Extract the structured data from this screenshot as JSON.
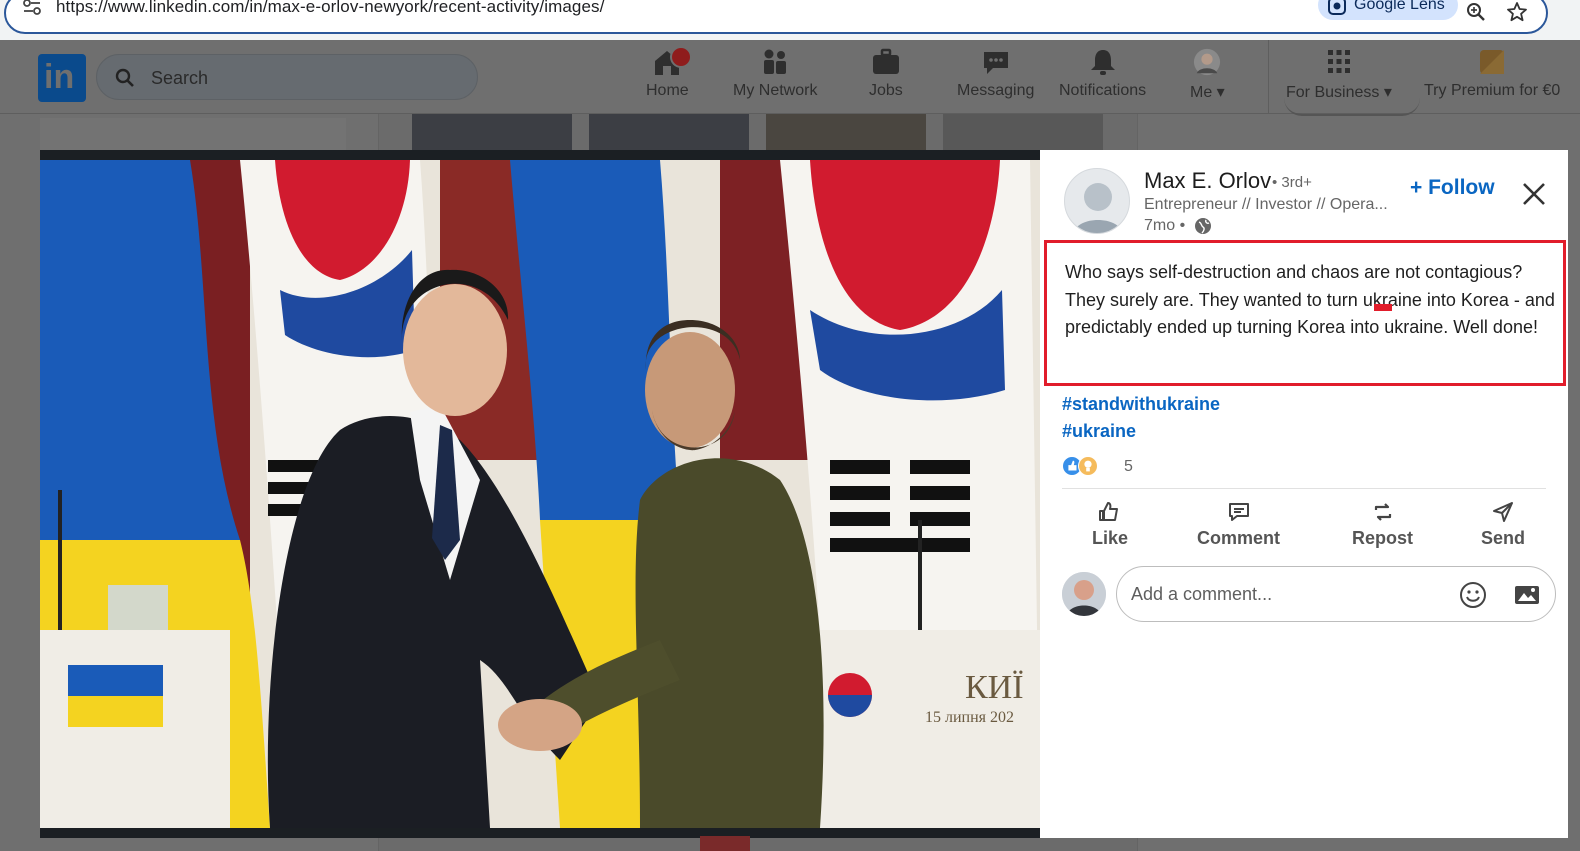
{
  "browser": {
    "url": "https://www.linkedin.com/in/max-e-orlov-newyork/recent-activity/images/",
    "lens_label": "Google Lens"
  },
  "header": {
    "logo_text": "in",
    "search_placeholder": "Search",
    "nav": [
      {
        "label": "Home",
        "icon": "home-icon",
        "badge": true
      },
      {
        "label": "My Network",
        "icon": "network-icon"
      },
      {
        "label": "Jobs",
        "icon": "briefcase-icon"
      },
      {
        "label": "Messaging",
        "icon": "message-icon"
      },
      {
        "label": "Notifications",
        "icon": "bell-icon"
      },
      {
        "label": "Me",
        "icon": "avatar-icon",
        "dropdown": true
      },
      {
        "label": "For Business",
        "icon": "grid-icon",
        "dropdown": true
      },
      {
        "label": "Try Premium for €0",
        "icon": "premium-icon"
      }
    ]
  },
  "post": {
    "author": "Max E. Orlov",
    "degree": "• 3rd+",
    "headline": "Entrepreneur // Investor // Opera...",
    "time": "7mo •",
    "follow_label": "+ Follow",
    "text": "Who says self-destruction and chaos are not contagious? They surely are. They wanted to turn ukraine into Korea - and predictably ended up turning Korea into ukraine. Well done!",
    "hashtags": [
      "#standwithukraine",
      "#ukraine"
    ],
    "reaction_count": "5",
    "actions": [
      {
        "label": "Like",
        "icon": "like-icon"
      },
      {
        "label": "Comment",
        "icon": "comment-icon"
      },
      {
        "label": "Repost",
        "icon": "repost-icon"
      },
      {
        "label": "Send",
        "icon": "send-icon"
      }
    ],
    "comment_placeholder": "Add a comment..."
  },
  "photo": {
    "podium_sign": "КИЇ",
    "podium_date": "15 липня 202"
  },
  "colors": {
    "linkedin_blue": "#0a66c2",
    "highlight_red": "#e11d2b",
    "ukraine_blue": "#1a5bb8",
    "ukraine_yellow": "#f4d320"
  }
}
